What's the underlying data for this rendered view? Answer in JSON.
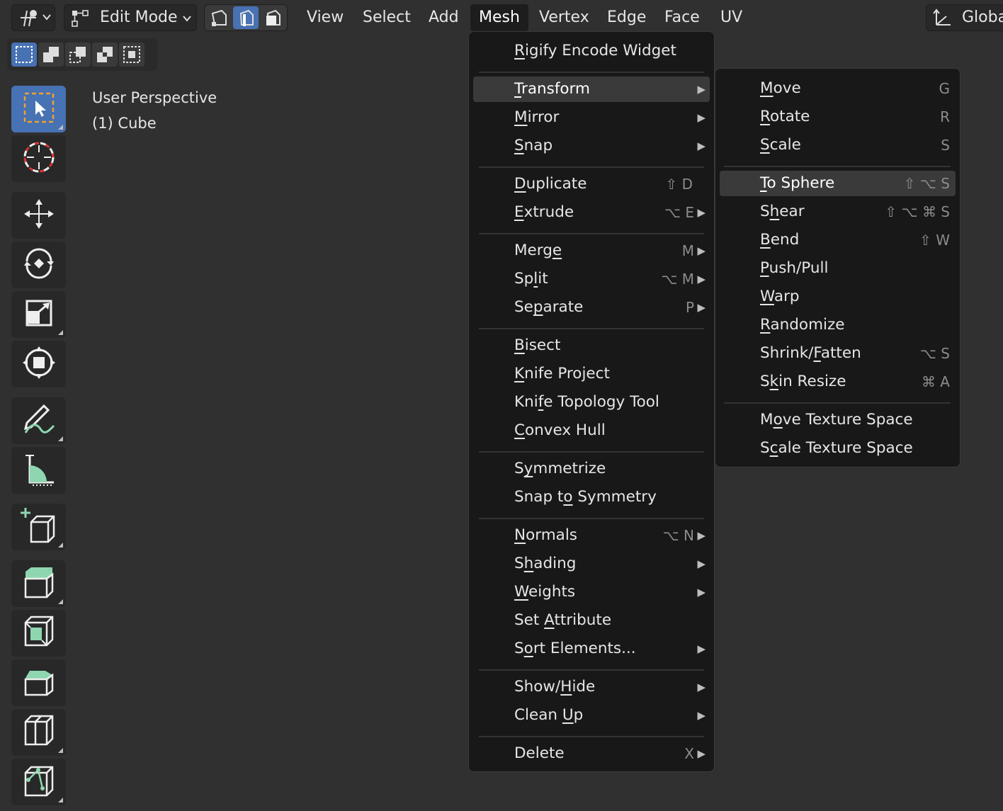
{
  "header": {
    "mode_label": "Edit Mode",
    "menus": [
      "View",
      "Select",
      "Add",
      "Mesh",
      "Vertex",
      "Edge",
      "Face",
      "UV"
    ],
    "active_menu": "Mesh",
    "orientation_label": "Globa",
    "icons": {
      "editor_type": "editor-type-icon",
      "mode": "edit-mode-icon",
      "vertex_select": "vertex-select-icon",
      "edge_select": "edge-select-icon",
      "face_select": "face-select-icon",
      "orientation": "transform-orientation-icon"
    },
    "active_select_mode": "edge"
  },
  "viewport": {
    "line1": "User Perspective",
    "line2": "(1) Cube"
  },
  "toolbar": [
    {
      "name": "select-box-tool",
      "icon": "select-box-icon",
      "active": true
    },
    {
      "name": "cursor-tool",
      "icon": "cursor-icon",
      "active": false
    },
    {
      "name": "move-tool",
      "icon": "move-icon",
      "active": false
    },
    {
      "name": "rotate-tool",
      "icon": "rotate-icon",
      "active": false
    },
    {
      "name": "scale-tool",
      "icon": "scale-icon",
      "active": false
    },
    {
      "name": "transform-tool",
      "icon": "transform-icon",
      "active": false
    },
    {
      "name": "annotate-tool",
      "icon": "annotate-icon",
      "active": false
    },
    {
      "name": "measure-tool",
      "icon": "measure-icon",
      "active": false
    },
    {
      "name": "add-cube-tool",
      "icon": "add-cube-icon",
      "active": false
    },
    {
      "name": "extrude-region-tool",
      "icon": "extrude-region-icon",
      "active": false
    },
    {
      "name": "inset-faces-tool",
      "icon": "inset-faces-icon",
      "active": false
    },
    {
      "name": "bevel-tool",
      "icon": "bevel-icon",
      "active": false
    },
    {
      "name": "loop-cut-tool",
      "icon": "loop-cut-icon",
      "active": false
    },
    {
      "name": "knife-tool",
      "icon": "knife-icon",
      "active": false
    }
  ],
  "mesh_menu": {
    "items": [
      {
        "label": "Rigify Encode Widget",
        "u": 0,
        "shortcut": "",
        "submenu": false
      },
      {
        "sep": true
      },
      {
        "label": "Transform",
        "u": 0,
        "shortcut": "",
        "submenu": true,
        "highlighted": true
      },
      {
        "label": "Mirror",
        "u": 0,
        "shortcut": "",
        "submenu": true
      },
      {
        "label": "Snap",
        "u": 0,
        "shortcut": "",
        "submenu": true
      },
      {
        "sep": true
      },
      {
        "label": "Duplicate",
        "u": 0,
        "shortcut": "⇧ D",
        "submenu": false
      },
      {
        "label": "Extrude",
        "u": 0,
        "shortcut": "⌥ E",
        "submenu": true
      },
      {
        "sep": true
      },
      {
        "label": "Merge",
        "u": 4,
        "shortcut": "M",
        "submenu": true
      },
      {
        "label": "Split",
        "u": 2,
        "shortcut": "⌥ M",
        "submenu": true
      },
      {
        "label": "Separate",
        "u": 2,
        "shortcut": "P",
        "submenu": true
      },
      {
        "sep": true
      },
      {
        "label": "Bisect",
        "u": 0,
        "shortcut": "",
        "submenu": false
      },
      {
        "label": "Knife Project",
        "u": 0,
        "shortcut": "",
        "submenu": false
      },
      {
        "label": "Knife Topology Tool",
        "u": 3,
        "shortcut": "",
        "submenu": false
      },
      {
        "label": "Convex Hull",
        "u": 0,
        "shortcut": "",
        "submenu": false
      },
      {
        "sep": true
      },
      {
        "label": "Symmetrize",
        "u": 1,
        "shortcut": "",
        "submenu": false
      },
      {
        "label": "Snap to Symmetry",
        "u": 6,
        "shortcut": "",
        "submenu": false
      },
      {
        "sep": true
      },
      {
        "label": "Normals",
        "u": 0,
        "shortcut": "⌥ N",
        "submenu": true
      },
      {
        "label": "Shading",
        "u": 1,
        "shortcut": "",
        "submenu": true
      },
      {
        "label": "Weights",
        "u": 0,
        "shortcut": "",
        "submenu": true
      },
      {
        "label": "Set Attribute",
        "u": 4,
        "shortcut": "",
        "submenu": false
      },
      {
        "label": "Sort Elements...",
        "u": 1,
        "shortcut": "",
        "submenu": true
      },
      {
        "sep": true
      },
      {
        "label": "Show/Hide",
        "u": 5,
        "shortcut": "",
        "submenu": true
      },
      {
        "label": "Clean Up",
        "u": 6,
        "shortcut": "",
        "submenu": true
      },
      {
        "sep": true
      },
      {
        "label": "Delete",
        "u": -1,
        "shortcut": "X",
        "submenu": true
      }
    ]
  },
  "transform_menu": {
    "items": [
      {
        "label": "Move",
        "u": 0,
        "shortcut": "G"
      },
      {
        "label": "Rotate",
        "u": 0,
        "shortcut": "R"
      },
      {
        "label": "Scale",
        "u": 0,
        "shortcut": "S"
      },
      {
        "sep": true
      },
      {
        "label": "To Sphere",
        "u": 0,
        "shortcut": "⇧ ⌥ S",
        "highlighted": true
      },
      {
        "label": "Shear",
        "u": 1,
        "shortcut": "⇧ ⌥ ⌘ S"
      },
      {
        "label": "Bend",
        "u": 0,
        "shortcut": "⇧ W"
      },
      {
        "label": "Push/Pull",
        "u": 0,
        "shortcut": ""
      },
      {
        "label": "Warp",
        "u": 0,
        "shortcut": ""
      },
      {
        "label": "Randomize",
        "u": 0,
        "shortcut": ""
      },
      {
        "label": "Shrink/Fatten",
        "u": 7,
        "shortcut": "⌥ S"
      },
      {
        "label": "Skin Resize",
        "u": 1,
        "shortcut": "⌘ A"
      },
      {
        "sep": true
      },
      {
        "label": "Move Texture Space",
        "u": 1,
        "shortcut": ""
      },
      {
        "label": "Scale Texture Space",
        "u": 1,
        "shortcut": ""
      }
    ]
  },
  "colors": {
    "accent": "#4772b3",
    "highlight": "#3a3a3a",
    "tool_green": "#8fd6b0"
  }
}
